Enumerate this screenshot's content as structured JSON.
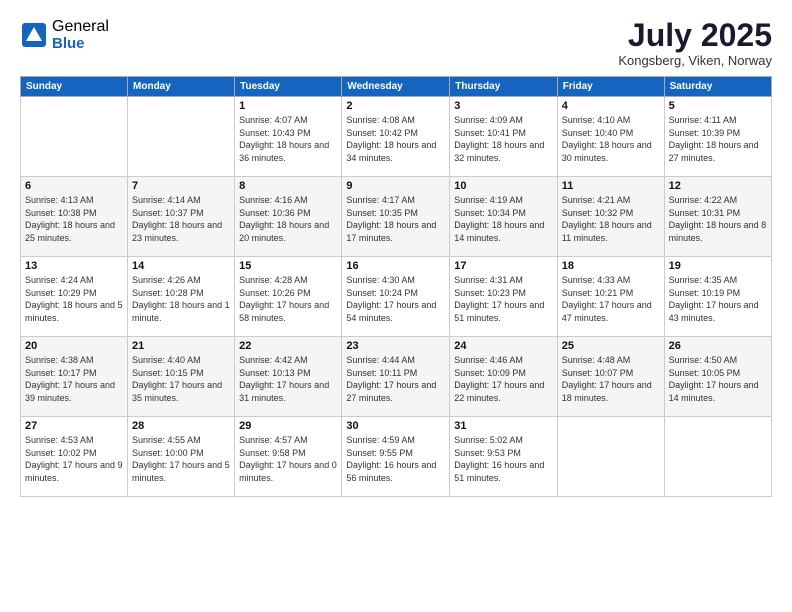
{
  "logo": {
    "general": "General",
    "blue": "Blue"
  },
  "title": "July 2025",
  "location": "Kongsberg, Viken, Norway",
  "days_of_week": [
    "Sunday",
    "Monday",
    "Tuesday",
    "Wednesday",
    "Thursday",
    "Friday",
    "Saturday"
  ],
  "weeks": [
    [
      {
        "day": "",
        "info": ""
      },
      {
        "day": "",
        "info": ""
      },
      {
        "day": "1",
        "info": "Sunrise: 4:07 AM\nSunset: 10:43 PM\nDaylight: 18 hours\nand 36 minutes."
      },
      {
        "day": "2",
        "info": "Sunrise: 4:08 AM\nSunset: 10:42 PM\nDaylight: 18 hours\nand 34 minutes."
      },
      {
        "day": "3",
        "info": "Sunrise: 4:09 AM\nSunset: 10:41 PM\nDaylight: 18 hours\nand 32 minutes."
      },
      {
        "day": "4",
        "info": "Sunrise: 4:10 AM\nSunset: 10:40 PM\nDaylight: 18 hours\nand 30 minutes."
      },
      {
        "day": "5",
        "info": "Sunrise: 4:11 AM\nSunset: 10:39 PM\nDaylight: 18 hours\nand 27 minutes."
      }
    ],
    [
      {
        "day": "6",
        "info": "Sunrise: 4:13 AM\nSunset: 10:38 PM\nDaylight: 18 hours\nand 25 minutes."
      },
      {
        "day": "7",
        "info": "Sunrise: 4:14 AM\nSunset: 10:37 PM\nDaylight: 18 hours\nand 23 minutes."
      },
      {
        "day": "8",
        "info": "Sunrise: 4:16 AM\nSunset: 10:36 PM\nDaylight: 18 hours\nand 20 minutes."
      },
      {
        "day": "9",
        "info": "Sunrise: 4:17 AM\nSunset: 10:35 PM\nDaylight: 18 hours\nand 17 minutes."
      },
      {
        "day": "10",
        "info": "Sunrise: 4:19 AM\nSunset: 10:34 PM\nDaylight: 18 hours\nand 14 minutes."
      },
      {
        "day": "11",
        "info": "Sunrise: 4:21 AM\nSunset: 10:32 PM\nDaylight: 18 hours\nand 11 minutes."
      },
      {
        "day": "12",
        "info": "Sunrise: 4:22 AM\nSunset: 10:31 PM\nDaylight: 18 hours\nand 8 minutes."
      }
    ],
    [
      {
        "day": "13",
        "info": "Sunrise: 4:24 AM\nSunset: 10:29 PM\nDaylight: 18 hours\nand 5 minutes."
      },
      {
        "day": "14",
        "info": "Sunrise: 4:26 AM\nSunset: 10:28 PM\nDaylight: 18 hours\nand 1 minute."
      },
      {
        "day": "15",
        "info": "Sunrise: 4:28 AM\nSunset: 10:26 PM\nDaylight: 17 hours\nand 58 minutes."
      },
      {
        "day": "16",
        "info": "Sunrise: 4:30 AM\nSunset: 10:24 PM\nDaylight: 17 hours\nand 54 minutes."
      },
      {
        "day": "17",
        "info": "Sunrise: 4:31 AM\nSunset: 10:23 PM\nDaylight: 17 hours\nand 51 minutes."
      },
      {
        "day": "18",
        "info": "Sunrise: 4:33 AM\nSunset: 10:21 PM\nDaylight: 17 hours\nand 47 minutes."
      },
      {
        "day": "19",
        "info": "Sunrise: 4:35 AM\nSunset: 10:19 PM\nDaylight: 17 hours\nand 43 minutes."
      }
    ],
    [
      {
        "day": "20",
        "info": "Sunrise: 4:38 AM\nSunset: 10:17 PM\nDaylight: 17 hours\nand 39 minutes."
      },
      {
        "day": "21",
        "info": "Sunrise: 4:40 AM\nSunset: 10:15 PM\nDaylight: 17 hours\nand 35 minutes."
      },
      {
        "day": "22",
        "info": "Sunrise: 4:42 AM\nSunset: 10:13 PM\nDaylight: 17 hours\nand 31 minutes."
      },
      {
        "day": "23",
        "info": "Sunrise: 4:44 AM\nSunset: 10:11 PM\nDaylight: 17 hours\nand 27 minutes."
      },
      {
        "day": "24",
        "info": "Sunrise: 4:46 AM\nSunset: 10:09 PM\nDaylight: 17 hours\nand 22 minutes."
      },
      {
        "day": "25",
        "info": "Sunrise: 4:48 AM\nSunset: 10:07 PM\nDaylight: 17 hours\nand 18 minutes."
      },
      {
        "day": "26",
        "info": "Sunrise: 4:50 AM\nSunset: 10:05 PM\nDaylight: 17 hours\nand 14 minutes."
      }
    ],
    [
      {
        "day": "27",
        "info": "Sunrise: 4:53 AM\nSunset: 10:02 PM\nDaylight: 17 hours\nand 9 minutes."
      },
      {
        "day": "28",
        "info": "Sunrise: 4:55 AM\nSunset: 10:00 PM\nDaylight: 17 hours\nand 5 minutes."
      },
      {
        "day": "29",
        "info": "Sunrise: 4:57 AM\nSunset: 9:58 PM\nDaylight: 17 hours\nand 0 minutes."
      },
      {
        "day": "30",
        "info": "Sunrise: 4:59 AM\nSunset: 9:55 PM\nDaylight: 16 hours\nand 56 minutes."
      },
      {
        "day": "31",
        "info": "Sunrise: 5:02 AM\nSunset: 9:53 PM\nDaylight: 16 hours\nand 51 minutes."
      },
      {
        "day": "",
        "info": ""
      },
      {
        "day": "",
        "info": ""
      }
    ]
  ]
}
